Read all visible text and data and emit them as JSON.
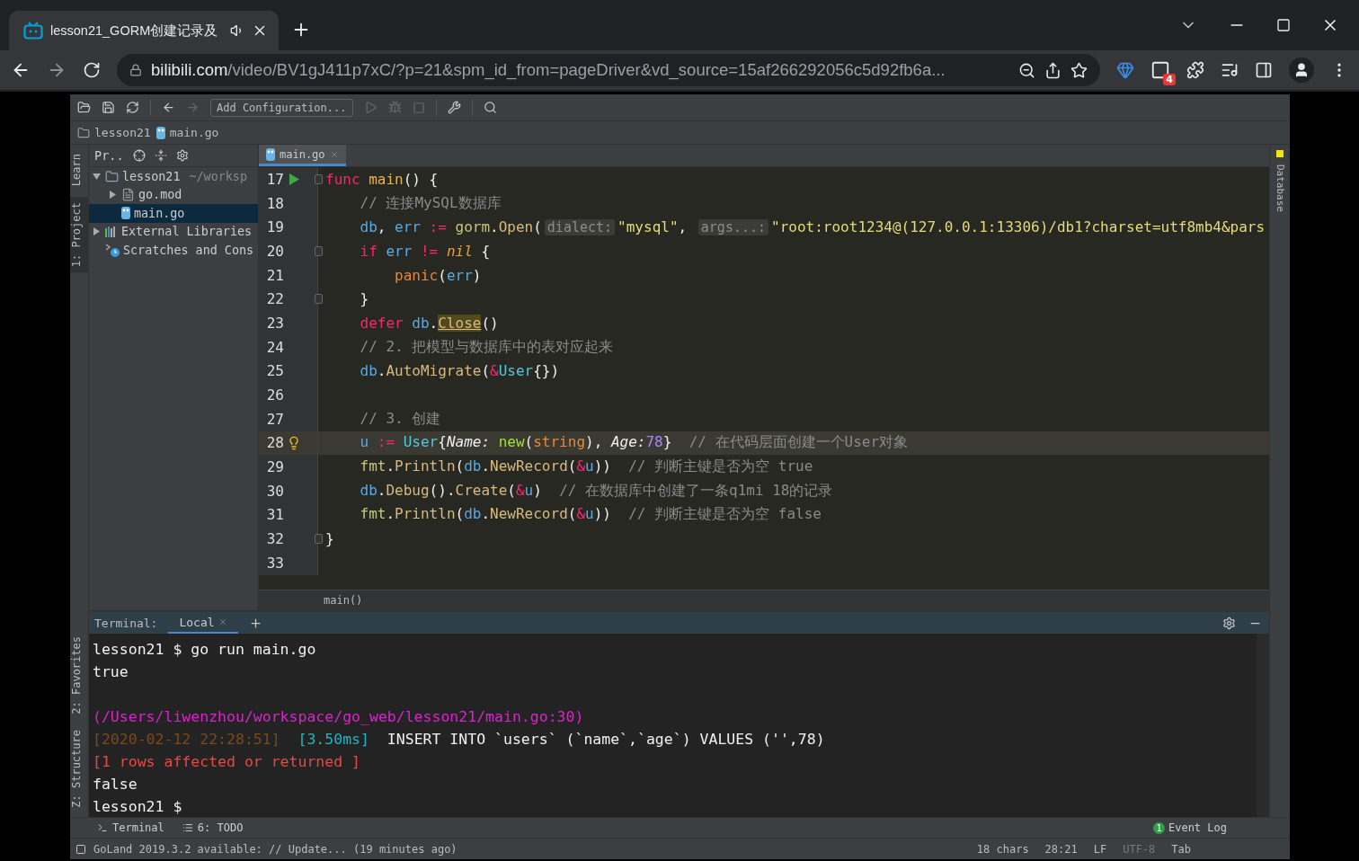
{
  "browser": {
    "tab": {
      "title": "lesson21_GORM创建记录及",
      "audio": true
    },
    "address": {
      "host": "bilibili.com",
      "path": "/video/BV1gJ411p7xC/?p=21&spm_id_from=pageDriver&vd_source=15af266292056c5d92fb6a..."
    },
    "extension_badge": "4"
  },
  "ide": {
    "toolbar": {
      "run_config": "Add Configuration..."
    },
    "breadcrumb": [
      "lesson21",
      "main.go"
    ],
    "left_strip_top": [
      {
        "label": "Learn",
        "selected": false
      },
      {
        "label": "1: Project",
        "selected": true
      }
    ],
    "left_strip_bottom": [
      {
        "label": "2: Favorites",
        "selected": false
      },
      {
        "label": "Z: Structure",
        "selected": false
      }
    ],
    "right_strip": [
      "Database"
    ],
    "project": {
      "title": "Pr..",
      "tree": [
        {
          "label": "lesson21",
          "hint": "~/worksp",
          "kind": "folder",
          "expanded": true,
          "selected": false,
          "children": [
            {
              "label": "go.mod",
              "kind": "file",
              "expanded": false,
              "selected": false
            },
            {
              "label": "main.go",
              "kind": "gofile",
              "selected": true
            }
          ]
        },
        {
          "label": "External Libraries",
          "kind": "libraries",
          "expanded": false,
          "selected": false
        },
        {
          "label": "Scratches and Cons",
          "kind": "scratches",
          "selected": false
        }
      ]
    },
    "editor": {
      "tab": "main.go",
      "function_breadcrumb": "main()",
      "lines": [
        {
          "number": "17",
          "current": false,
          "fold": true,
          "runnable": true,
          "intention": false,
          "tokens": [
            {
              "text": "func ",
              "kind": "kw"
            },
            {
              "text": "main",
              "kind": "fn"
            },
            {
              "text": "() {",
              "kind": "punct"
            }
          ]
        },
        {
          "number": "18",
          "current": false,
          "fold": false,
          "runnable": false,
          "intention": false,
          "tokens": [
            {
              "text": "    // 连接MySQL数据库",
              "kind": "comment"
            }
          ]
        },
        {
          "number": "19",
          "current": false,
          "fold": false,
          "runnable": false,
          "intention": false,
          "tokens": [
            {
              "text": "    db",
              "kind": "var"
            },
            {
              "text": ", ",
              "kind": "punct"
            },
            {
              "text": "err",
              "kind": "var"
            },
            {
              "text": " := ",
              "kind": "kw"
            },
            {
              "text": "gorm",
              "kind": "pkg"
            },
            {
              "text": ".",
              "kind": "punct"
            },
            {
              "text": "Open",
              "kind": "method"
            },
            {
              "text": "(",
              "kind": "punct"
            },
            {
              "text": "dialect:",
              "kind": "hint"
            },
            {
              "text": "\"mysql\"",
              "kind": "str"
            },
            {
              "text": ", ",
              "kind": "punct"
            },
            {
              "text": "args...:",
              "kind": "hint"
            },
            {
              "text": "\"root:root1234@(127.0.0.1:13306)/db1?charset=utf8mb4&pars",
              "kind": "str"
            }
          ]
        },
        {
          "number": "20",
          "current": false,
          "fold": true,
          "runnable": false,
          "intention": false,
          "tokens": [
            {
              "text": "    if ",
              "kind": "kw"
            },
            {
              "text": "err",
              "kind": "var"
            },
            {
              "text": " != ",
              "kind": "kw"
            },
            {
              "text": "nil",
              "kind": "nil"
            },
            {
              "text": " {",
              "kind": "punct"
            }
          ]
        },
        {
          "number": "21",
          "current": false,
          "fold": false,
          "runnable": false,
          "intention": false,
          "tokens": [
            {
              "text": "        panic",
              "kind": "builtinfn"
            },
            {
              "text": "(",
              "kind": "punct"
            },
            {
              "text": "err",
              "kind": "var"
            },
            {
              "text": ")",
              "kind": "punct"
            }
          ]
        },
        {
          "number": "22",
          "current": false,
          "fold": true,
          "runnable": false,
          "intention": false,
          "tokens": [
            {
              "text": "    }",
              "kind": "punct"
            }
          ]
        },
        {
          "number": "23",
          "current": false,
          "fold": false,
          "runnable": false,
          "intention": false,
          "tokens": [
            {
              "text": "    defer ",
              "kind": "kw"
            },
            {
              "text": "db",
              "kind": "var"
            },
            {
              "text": ".",
              "kind": "punct"
            },
            {
              "text": "Close",
              "kind": "deprecated"
            },
            {
              "text": "()",
              "kind": "punct"
            }
          ]
        },
        {
          "number": "24",
          "current": false,
          "fold": false,
          "runnable": false,
          "intention": false,
          "tokens": [
            {
              "text": "    // 2. 把模型与数据库中的表对应起来",
              "kind": "comment"
            }
          ]
        },
        {
          "number": "25",
          "current": false,
          "fold": false,
          "runnable": false,
          "intention": false,
          "tokens": [
            {
              "text": "    db",
              "kind": "var"
            },
            {
              "text": ".",
              "kind": "punct"
            },
            {
              "text": "AutoMigrate",
              "kind": "method"
            },
            {
              "text": "(",
              "kind": "punct"
            },
            {
              "text": "&",
              "kind": "kw"
            },
            {
              "text": "User",
              "kind": "type"
            },
            {
              "text": "{})",
              "kind": "punct"
            }
          ]
        },
        {
          "number": "26",
          "current": false,
          "fold": false,
          "runnable": false,
          "intention": false
        },
        {
          "number": "27",
          "current": false,
          "fold": false,
          "runnable": false,
          "intention": false,
          "tokens": [
            {
              "text": "    // 3. 创建",
              "kind": "comment"
            }
          ]
        },
        {
          "number": "28",
          "current": true,
          "fold": false,
          "runnable": false,
          "intention": true,
          "tokens": [
            {
              "text": "    u",
              "kind": "var"
            },
            {
              "text": " := ",
              "kind": "kw"
            },
            {
              "text": "User",
              "kind": "type"
            },
            {
              "text": "{",
              "kind": "punct"
            },
            {
              "text": "Name: ",
              "kind": "field"
            },
            {
              "text": "new",
              "kind": "builtin"
            },
            {
              "text": "(",
              "kind": "punct"
            },
            {
              "text": "string",
              "kind": "typekw"
            },
            {
              "text": "), ",
              "kind": "punct"
            },
            {
              "text": "Age:",
              "kind": "field"
            },
            {
              "text": "78",
              "kind": "num"
            },
            {
              "text": "}  ",
              "kind": "punct"
            },
            {
              "text": "// 在代码层面创建一个User对象",
              "kind": "comment"
            }
          ]
        },
        {
          "number": "29",
          "current": false,
          "fold": false,
          "runnable": false,
          "intention": false,
          "tokens": [
            {
              "text": "    fmt",
              "kind": "pkg"
            },
            {
              "text": ".",
              "kind": "punct"
            },
            {
              "text": "Println",
              "kind": "method"
            },
            {
              "text": "(",
              "kind": "punct"
            },
            {
              "text": "db",
              "kind": "var"
            },
            {
              "text": ".",
              "kind": "punct"
            },
            {
              "text": "NewRecord",
              "kind": "method"
            },
            {
              "text": "(",
              "kind": "punct"
            },
            {
              "text": "&",
              "kind": "kw"
            },
            {
              "text": "u",
              "kind": "var"
            },
            {
              "text": "))  ",
              "kind": "punct"
            },
            {
              "text": "// 判断主键是否为空 true",
              "kind": "comment"
            }
          ]
        },
        {
          "number": "30",
          "current": false,
          "fold": false,
          "runnable": false,
          "intention": false,
          "tokens": [
            {
              "text": "    db",
              "kind": "var"
            },
            {
              "text": ".",
              "kind": "punct"
            },
            {
              "text": "Debug",
              "kind": "method"
            },
            {
              "text": "().",
              "kind": "punct"
            },
            {
              "text": "Create",
              "kind": "method"
            },
            {
              "text": "(",
              "kind": "punct"
            },
            {
              "text": "&",
              "kind": "kw"
            },
            {
              "text": "u",
              "kind": "var"
            },
            {
              "text": ")  ",
              "kind": "punct"
            },
            {
              "text": "// 在数据库中创建了一条q1mi 18的记录",
              "kind": "comment"
            }
          ]
        },
        {
          "number": "31",
          "current": false,
          "fold": false,
          "runnable": false,
          "intention": false,
          "tokens": [
            {
              "text": "    fmt",
              "kind": "pkg"
            },
            {
              "text": ".",
              "kind": "punct"
            },
            {
              "text": "Println",
              "kind": "method"
            },
            {
              "text": "(",
              "kind": "punct"
            },
            {
              "text": "db",
              "kind": "var"
            },
            {
              "text": ".",
              "kind": "punct"
            },
            {
              "text": "NewRecord",
              "kind": "method"
            },
            {
              "text": "(",
              "kind": "punct"
            },
            {
              "text": "&",
              "kind": "kw"
            },
            {
              "text": "u",
              "kind": "var"
            },
            {
              "text": "))  ",
              "kind": "punct"
            },
            {
              "text": "// 判断主键是否为空 false",
              "kind": "comment"
            }
          ]
        },
        {
          "number": "32",
          "current": false,
          "fold": true,
          "runnable": false,
          "intention": false,
          "tokens": [
            {
              "text": "}",
              "kind": "punct"
            }
          ]
        },
        {
          "number": "33",
          "current": false,
          "fold": false,
          "runnable": false,
          "intention": false
        }
      ]
    },
    "terminal": {
      "title": "Terminal:",
      "tabs": [
        {
          "label": "Local",
          "selected": true
        }
      ],
      "lines": [
        {
          "blank_before": false,
          "segments": [
            {
              "text": "lesson21 $ go run main.go",
              "kind": "plain"
            }
          ]
        },
        {
          "blank_before": false,
          "segments": [
            {
              "text": "true",
              "kind": "plain"
            }
          ]
        },
        {
          "blank_before": true,
          "segments": [
            {
              "text": "(/Users/liwenzhou/workspace/go_web/lesson21/main.go:30)",
              "kind": "path"
            }
          ]
        },
        {
          "blank_before": false,
          "segments": [
            {
              "text": "[2020-02-12 22:28:51]",
              "kind": "time"
            },
            {
              "text": "  [3.50ms]",
              "kind": "duration"
            },
            {
              "text": "  INSERT INTO `users` (`name`,`age`) VALUES ('',78)",
              "kind": "plain"
            }
          ]
        },
        {
          "blank_before": false,
          "segments": [
            {
              "text": "[1 rows affected or returned ]",
              "kind": "error"
            }
          ]
        },
        {
          "blank_before": false,
          "segments": [
            {
              "text": "false",
              "kind": "plain"
            }
          ]
        },
        {
          "blank_before": false,
          "segments": [
            {
              "text": "lesson21 $",
              "kind": "plain"
            }
          ]
        }
      ]
    },
    "bottom_tabs": [
      {
        "label": "Terminal",
        "kind": "terminal"
      },
      {
        "label": "6: TODO",
        "kind": "todo"
      }
    ],
    "event_log": {
      "count": "1",
      "label": "Event Log"
    },
    "status": {
      "message": "GoLand 2019.3.2 available: // Update... (19 minutes ago)",
      "items": [
        {
          "text": "18 chars",
          "dim": false
        },
        {
          "text": "28:21",
          "dim": false
        },
        {
          "text": "LF",
          "dim": false
        },
        {
          "text": "UTF-8",
          "dim": true
        },
        {
          "text": "Tab",
          "dim": false
        }
      ]
    }
  }
}
